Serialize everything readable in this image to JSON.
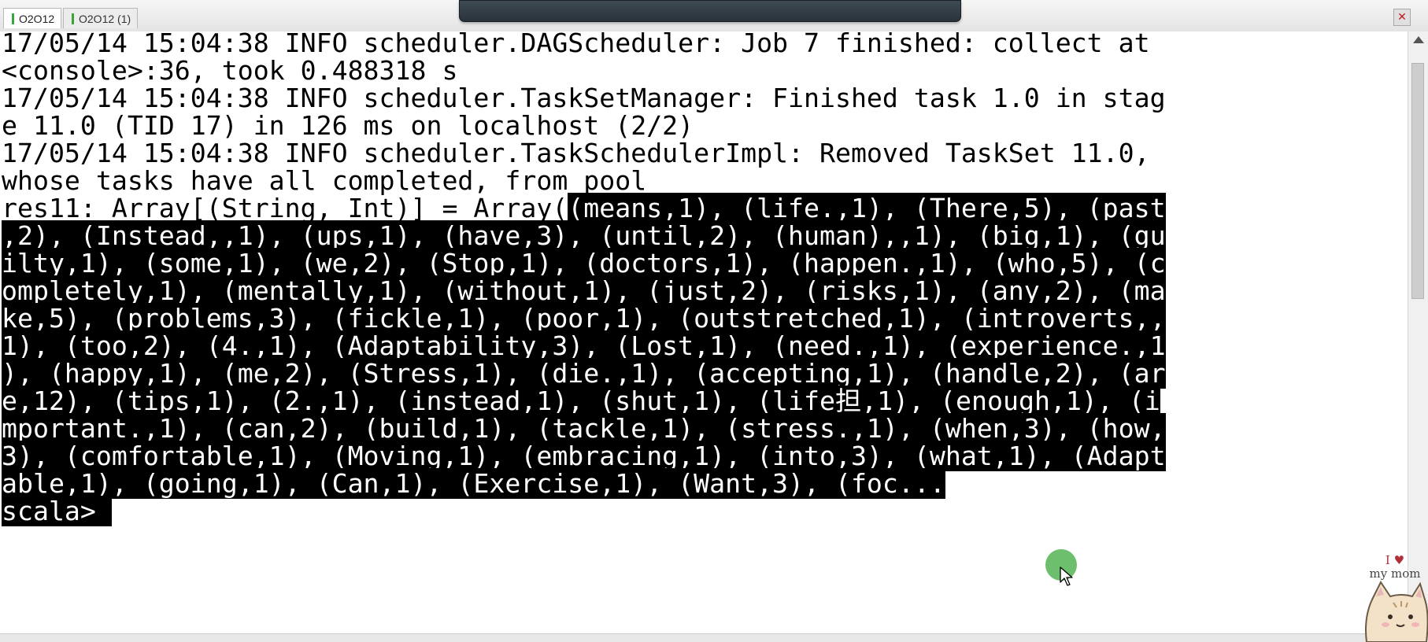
{
  "tabs": [
    {
      "label": "O2O12",
      "active": true
    },
    {
      "label": "O2O12 (1)",
      "active": false
    }
  ],
  "close_label": "✕",
  "terminal": {
    "lines": [
      {
        "text": "17/05/14 15:04:38 INFO scheduler.DAGScheduler: Job 7 finished: collect at",
        "highlighted": false
      },
      {
        "text": "<console>:36, took 0.488318 s",
        "highlighted": false
      },
      {
        "text": "17/05/14 15:04:38 INFO scheduler.TaskSetManager: Finished task 1.0 in stag",
        "highlighted": false
      },
      {
        "text": "e 11.0 (TID 17) in 126 ms on localhost (2/2)",
        "highlighted": false
      },
      {
        "text": "17/05/14 15:04:38 INFO scheduler.TaskSchedulerImpl: Removed TaskSet 11.0,",
        "highlighted": false
      },
      {
        "text": "whose tasks have all completed, from pool",
        "highlighted": false
      },
      {
        "prefix": "res11: Array[(String, Int)] = Array(",
        "text": "(means,1), (life.,1), (There,5), (past",
        "highlighted": true
      },
      {
        "text": ",2), (Instead,,1), (ups,1), (have,3), (until,2), (human),,1), (big,1), (gu",
        "highlighted": true
      },
      {
        "text": "ilty,1), (some,1), (we,2), (Stop,1), (doctors,1), (happen.,1), (who,5), (c",
        "highlighted": true
      },
      {
        "text": "ompletely,1), (mentally,1), (without,1), (just,2), (risks,1), (any,2), (ma",
        "highlighted": true
      },
      {
        "text": "ke,5), (problems,3), (fickle,1), (poor,1), (outstretched,1), (introverts,,",
        "highlighted": true
      },
      {
        "text": "1), (too,2), (4.,1), (Adaptability,3), (Lost,1), (need.,1), (experience.,1",
        "highlighted": true
      },
      {
        "text": "), (happy,1), (me,2), (Stress,1), (die.,1), (accepting,1), (handle,2), (ar",
        "highlighted": true
      },
      {
        "text": "e,12), (tips,1), (2.,1), (instead,1), (shut,1), (life担,1), (enough,1), (i",
        "highlighted": true
      },
      {
        "text": "mportant.,1), (can,2), (build,1), (tackle,1), (stress.,1), (when,3), (how,",
        "highlighted": true
      },
      {
        "text": "3), (comfortable,1), (Moving,1), (embracing,1), (into,3), (what,1), (Adapt",
        "highlighted": true
      },
      {
        "text": "able,1), (going,1), (Can,1), (Exercise,1), (Want,3), (foc...",
        "highlighted": true
      },
      {
        "text": "scala> ",
        "highlighted": true
      }
    ]
  },
  "watermark": {
    "line1": "I ♥",
    "line2": "my mom"
  },
  "icons": {
    "cursor": "mouse-pointer-icon",
    "close": "close-icon",
    "cat": "cat-sticker-icon"
  },
  "colors": {
    "highlight_bg": "#000000",
    "highlight_fg": "#ffffff",
    "cursor_halo": "#3caa3c",
    "close_x": "#c01818"
  }
}
